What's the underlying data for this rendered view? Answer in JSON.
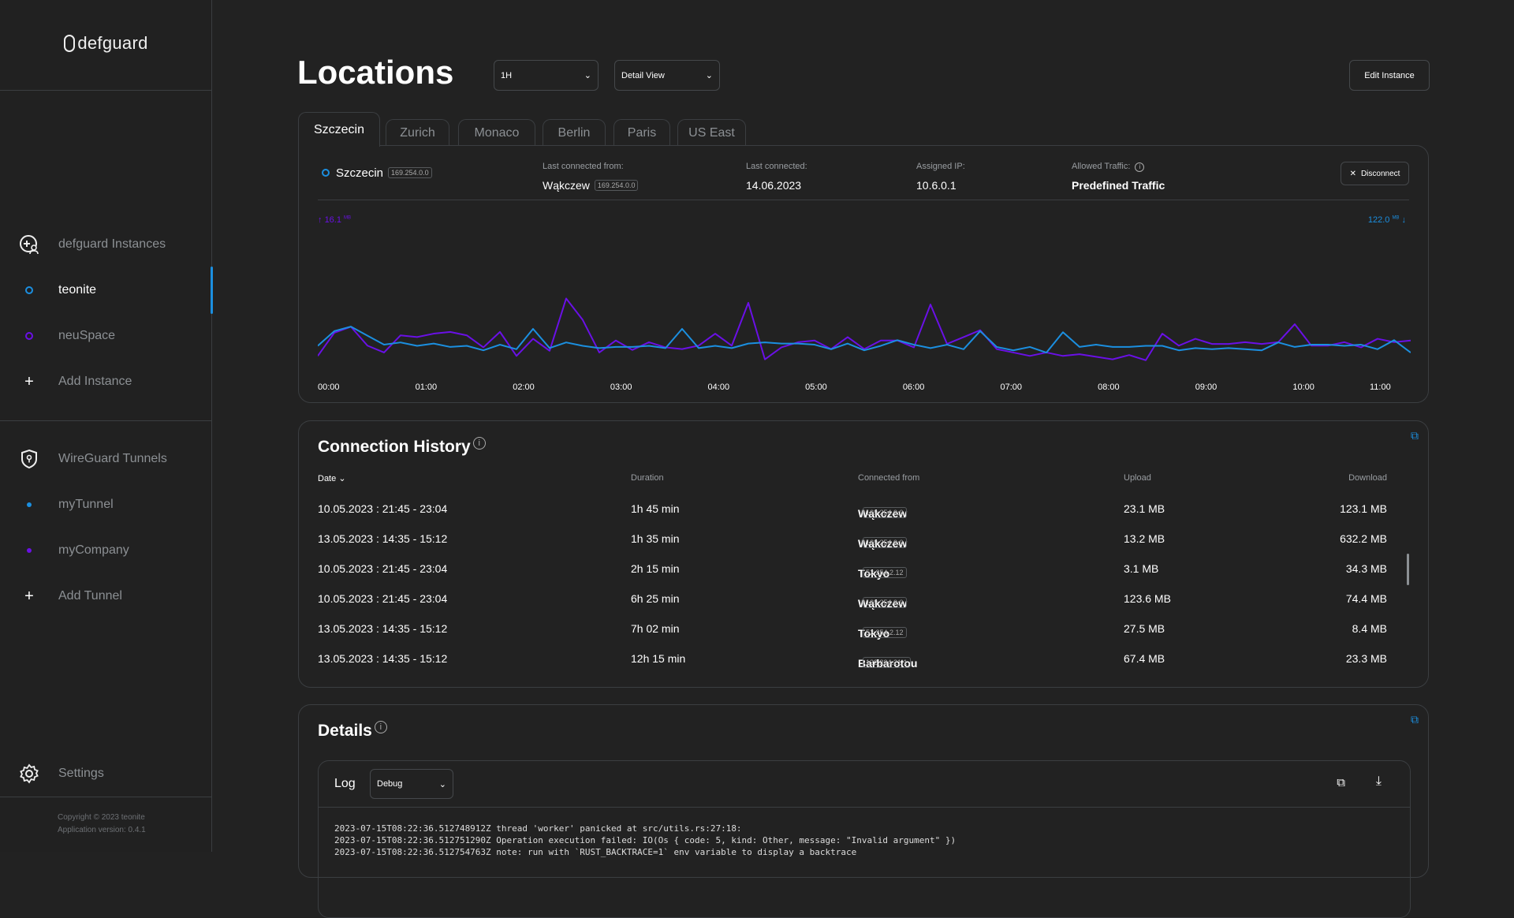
{
  "app": {
    "logo": "defguard",
    "copyright": "Copyright © 2023 teonite",
    "version": "Application version: 0.4.1"
  },
  "sidebar": {
    "instances_header": "defguard Instances",
    "instances": [
      {
        "label": "teonite",
        "color": "#1b8fe0",
        "active": true
      },
      {
        "label": "neuSpace",
        "color": "#6a10e6",
        "active": false
      }
    ],
    "add_instance": "Add Instance",
    "tunnels_header": "WireGuard Tunnels",
    "tunnels": [
      {
        "label": "myTunnel",
        "color": "#1b8fe0"
      },
      {
        "label": "myCompany",
        "color": "#6a10e6"
      }
    ],
    "add_tunnel": "Add Tunnel",
    "settings": "Settings"
  },
  "header": {
    "title": "Locations",
    "range_select": "1H",
    "view_select": "Detail View",
    "edit_button": "Edit Instance"
  },
  "tabs": [
    "Szczecin",
    "Zurich",
    "Monaco",
    "Berlin",
    "Paris",
    "US East"
  ],
  "location": {
    "name": "Szczecin",
    "ip": "169.254.0.0",
    "last_connected_from_label": "Last connected from:",
    "last_connected_from": "Wąkczew",
    "last_connected_from_ip": "169.254.0.0",
    "last_connected_label": "Last connected:",
    "last_connected": "14.06.2023",
    "assigned_ip_label": "Assigned IP:",
    "assigned_ip": "10.6.0.1",
    "allowed_traffic_label": "Allowed Traffic:",
    "allowed_traffic": "Predefined Traffic",
    "disconnect": "Disconnect"
  },
  "chart_data": {
    "type": "line",
    "upload_label": "16.1",
    "upload_unit": "MB",
    "download_label": "122.0",
    "download_unit": "MB",
    "x_ticks": [
      "00:00",
      "01:00",
      "02:00",
      "03:00",
      "04:00",
      "05:00",
      "06:00",
      "07:00",
      "08:00",
      "09:00",
      "10:00",
      "11:00"
    ],
    "x": [
      "00:00",
      "00:10",
      "00:20",
      "00:30",
      "00:40",
      "00:50",
      "01:00",
      "01:10",
      "01:20",
      "01:30",
      "01:40",
      "01:50",
      "02:00",
      "02:10",
      "02:20",
      "02:30",
      "02:40",
      "02:50",
      "03:00",
      "03:10",
      "03:20",
      "03:30",
      "03:40",
      "03:50",
      "04:00",
      "04:10",
      "04:20",
      "04:30",
      "04:40",
      "04:50",
      "05:00",
      "05:10",
      "05:20",
      "05:30",
      "05:40",
      "05:50",
      "06:00",
      "06:10",
      "06:20",
      "06:30",
      "06:40",
      "06:50",
      "07:00",
      "07:10",
      "07:20",
      "07:30",
      "07:40",
      "07:50",
      "08:00",
      "08:10",
      "08:20",
      "08:30",
      "08:40",
      "08:50",
      "09:00",
      "09:10",
      "09:20",
      "09:30",
      "09:40",
      "09:50",
      "10:00",
      "10:10",
      "10:20",
      "10:30",
      "10:40",
      "10:50",
      "11:00"
    ],
    "series": [
      {
        "key": "upload",
        "color": "#6a10e6",
        "ylim": [
          0,
          16.1
        ],
        "values": [
          0.8,
          3.5,
          4.2,
          2.0,
          1.2,
          3.2,
          3.0,
          3.4,
          3.6,
          3.2,
          1.8,
          3.6,
          0.8,
          2.8,
          1.4,
          7.5,
          5.0,
          1.2,
          2.6,
          1.5,
          2.4,
          1.8,
          1.6,
          2.0,
          3.4,
          2.0,
          7.0,
          0.4,
          1.8,
          2.4,
          2.6,
          1.6,
          3.0,
          1.6,
          2.6,
          2.6,
          1.8,
          6.8,
          2.2,
          3.0,
          3.8,
          1.6,
          1.2,
          0.8,
          1.2,
          0.8,
          1.0,
          0.7,
          0.4,
          0.9,
          0.3,
          3.4,
          2.0,
          2.8,
          2.2,
          2.2,
          2.4,
          2.2,
          2.4,
          4.5,
          2.0,
          2.0,
          2.4,
          1.8,
          2.8,
          2.4,
          2.6
        ]
      },
      {
        "key": "download",
        "color": "#1b8fe0",
        "ylim": [
          0,
          122
        ],
        "values": [
          15,
          28,
          32,
          24,
          16,
          18,
          15,
          17,
          14,
          15,
          11,
          16,
          12,
          30,
          13,
          18,
          15,
          13,
          14,
          14,
          15,
          13,
          30,
          13,
          15,
          13,
          17,
          18,
          17,
          17,
          16,
          12,
          17,
          11,
          15,
          20,
          16,
          13,
          16,
          12,
          28,
          14,
          11,
          14,
          9,
          27,
          14,
          16,
          14,
          14,
          15,
          15,
          11,
          13,
          12,
          13,
          12,
          11,
          18,
          14,
          16,
          16,
          15,
          16,
          12,
          20,
          9
        ]
      }
    ]
  },
  "history": {
    "title": "Connection History",
    "columns": [
      "Date",
      "Duration",
      "Connected from",
      "Upload",
      "Download"
    ],
    "rows": [
      {
        "date": "10.05.2023 : 21:45 - 23:04",
        "duration": "1h 45 min",
        "from": "Wąkczew",
        "ip": "169.254.0.0",
        "upload": "23.1 MB",
        "download": "123.1 MB"
      },
      {
        "date": "13.05.2023 : 14:35 - 15:12",
        "duration": "1h 35 min",
        "from": "Wąkczew",
        "ip": "169.254.0.0",
        "upload": "13.2 MB",
        "download": "632.2 MB"
      },
      {
        "date": "10.05.2023 : 21:45 - 23:04",
        "duration": "2h 15 min",
        "from": "Tokyo",
        "ip": "52.254.2.12",
        "upload": "3.1 MB",
        "download": "34.3 MB"
      },
      {
        "date": "10.05.2023 : 21:45 - 23:04",
        "duration": "6h 25 min",
        "from": "Wąkczew",
        "ip": "169.254.0.0",
        "upload": "123.6 MB",
        "download": "74.4 MB"
      },
      {
        "date": "13.05.2023 : 14:35 - 15:12",
        "duration": "7h 02 min",
        "from": "Tokyo",
        "ip": "52.254.2.12",
        "upload": "27.5 MB",
        "download": "8.4 MB"
      },
      {
        "date": "13.05.2023 : 14:35 - 15:12",
        "duration": "12h 15 min",
        "from": "Barbarotou",
        "ip": "122.234.21.1",
        "upload": "67.4 MB",
        "download": "23.3 MB"
      }
    ]
  },
  "details": {
    "title": "Details",
    "log_label": "Log",
    "log_level": "Debug",
    "lines": [
      "2023-07-15T08:22:36.512748912Z thread 'worker' panicked at src/utils.rs:27:18:",
      "2023-07-15T08:22:36.512751290Z Operation execution failed: IO(Os { code: 5, kind: Other, message: \"Invalid argument\" })",
      "2023-07-15T08:22:36.512754763Z note: run with `RUST_BACKTRACE=1` env variable to display a backtrace"
    ]
  }
}
